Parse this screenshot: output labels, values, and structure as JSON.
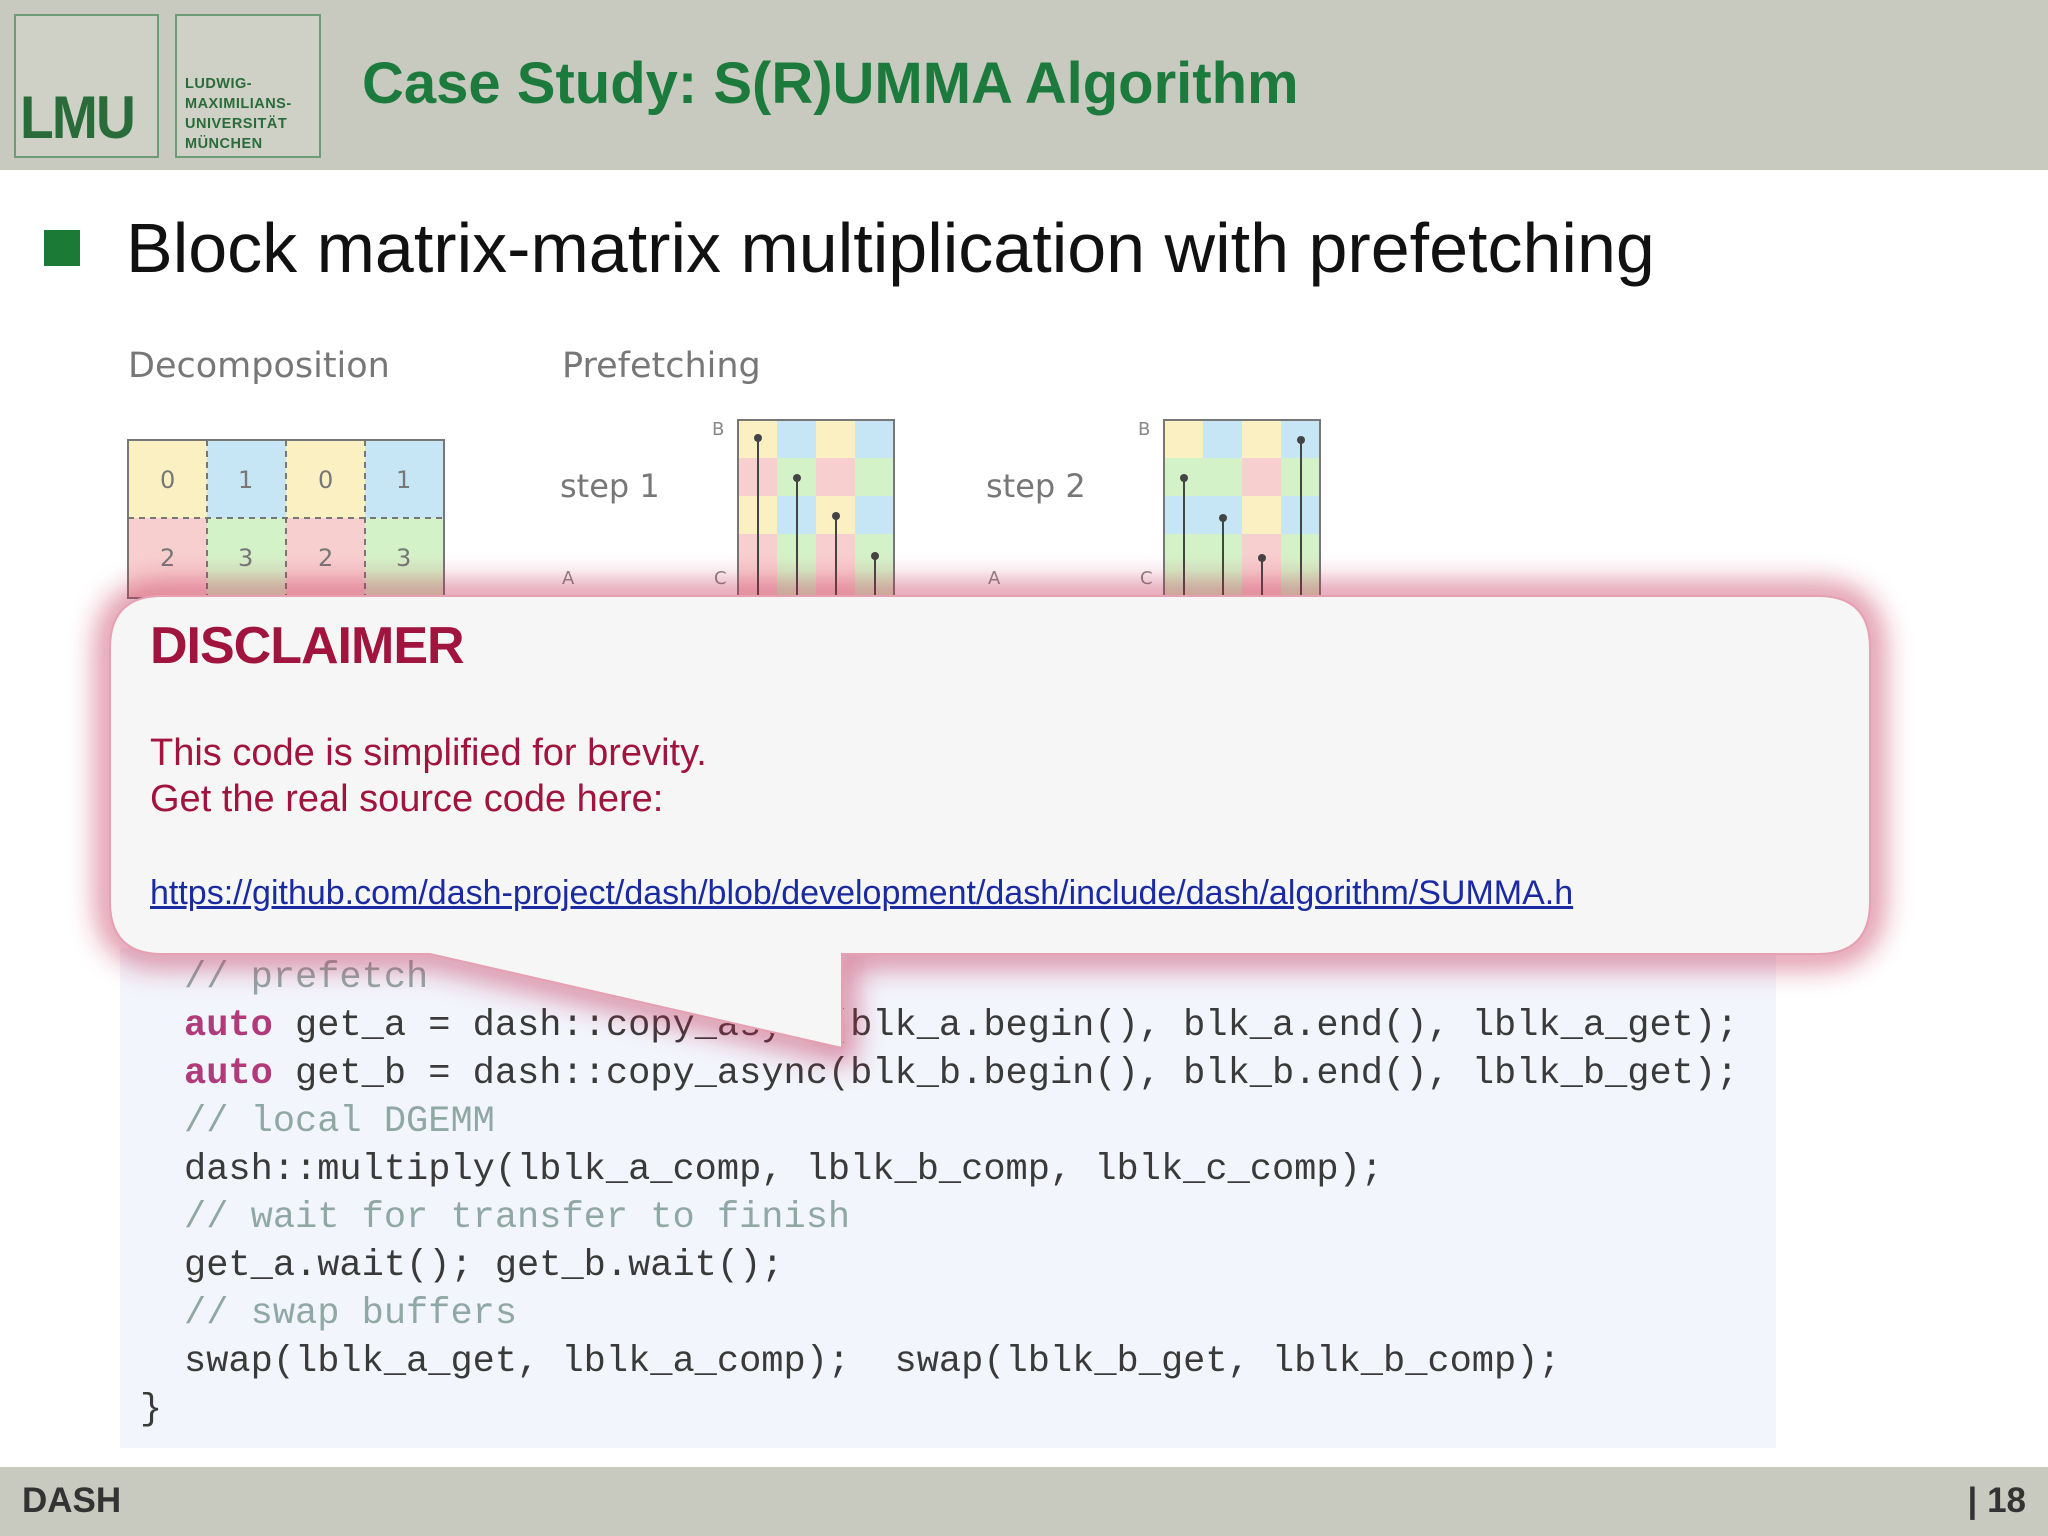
{
  "header": {
    "logo_mark": "LMU",
    "logo_name": [
      "LUDWIG-",
      "MAXIMILIANS-",
      "UNIVERSITÄT",
      "MÜNCHEN"
    ],
    "title": "Case Study: S(R)UMMA Algorithm"
  },
  "bullet": {
    "text": "Block matrix-matrix multiplication with prefetching"
  },
  "figure": {
    "decomposition_label": "Decomposition",
    "prefetching_label": "Prefetching",
    "block_ids_row1": [
      "0",
      "1",
      "0",
      "1"
    ],
    "block_ids_row2": [
      "2",
      "3",
      "2",
      "3"
    ],
    "step1": "step 1",
    "step2": "step 2",
    "matrix_a": "A",
    "matrix_b": "B",
    "matrix_c": "C"
  },
  "code": {
    "comment_prefetch": "// prefetch",
    "kw_auto": "auto",
    "line_get_a": " get_a = dash::copy_async(blk_a.begin(), blk_a.end(), lblk_a_get);",
    "line_get_b": " get_b = dash::copy_async(blk_b.begin(), blk_b.end(), lblk_b_get);",
    "comment_dgemm": "// local DGEMM",
    "line_multiply": "dash::multiply(lblk_a_comp, lblk_b_comp, lblk_c_comp);",
    "comment_wait": "// wait for transfer to finish",
    "line_wait": "get_a.wait(); get_b.wait();",
    "comment_swap": "// swap buffers",
    "line_swap": "swap(lblk_a_get, lblk_a_comp);  swap(lblk_b_get, lblk_b_comp);",
    "closing_brace": "}"
  },
  "disclaimer": {
    "title": "DISCLAIMER",
    "line1": "This code is simplified for brevity.",
    "line2": "Get the real source code here:",
    "link": "https://github.com/dash-project/dash/blob/development/dash/include/dash/algorithm/SUMMA.h"
  },
  "footer": {
    "left": "DASH",
    "right": "| 18"
  },
  "colors": {
    "title_green": "#1c7a3c",
    "bullet_green": "#1a7a36",
    "disclaimer_red": "#a0143e",
    "link_blue": "#1a2aa0",
    "code_bg": "#f2f5fb"
  }
}
